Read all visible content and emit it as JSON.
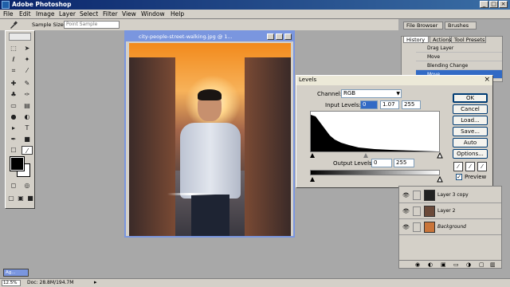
{
  "app": {
    "title": "Adobe Photoshop"
  },
  "menu": [
    "File",
    "Edit",
    "Image",
    "Layer",
    "Select",
    "Filter",
    "View",
    "Window",
    "Help"
  ],
  "options_bar": {
    "sample_size_label": "Sample Size:",
    "sample_size_value": "Point Sample"
  },
  "palette_well": {
    "file_browser": "File Browser",
    "brushes": "Brushes"
  },
  "document": {
    "title": "city-people-street-walking.jpg @ 1..."
  },
  "history_palette": {
    "tabs": [
      "History",
      "Actions",
      "Tool Presets"
    ],
    "items": [
      "Drag Layer",
      "Move",
      "Blending Change",
      "Move"
    ]
  },
  "levels_dialog": {
    "title": "Levels",
    "channel_label": "Channel:",
    "channel_value": "RGB",
    "input_label": "Input Levels:",
    "input_black": "0",
    "input_gamma": "1.07",
    "input_white": "255",
    "output_label": "Output Levels:",
    "output_black": "0",
    "output_white": "255",
    "buttons": {
      "ok": "OK",
      "cancel": "Cancel",
      "load": "Load...",
      "save": "Save...",
      "auto": "Auto",
      "options": "Options..."
    },
    "preview_label": "Preview",
    "preview_checked": true
  },
  "layers_palette": {
    "layers": [
      {
        "name": "Layer 3 copy",
        "italic": false
      },
      {
        "name": "Layer 2",
        "italic": false
      },
      {
        "name": "Background",
        "italic": true
      }
    ]
  },
  "minimized_doc": "Ag...",
  "status_bar": {
    "zoom": "12.5%",
    "doc_info": "Doc: 28.8M/194.7M"
  },
  "colors": {
    "title_bar": "#0a246a",
    "doc_title": "#7a96df",
    "highlight": "#316ac5"
  }
}
